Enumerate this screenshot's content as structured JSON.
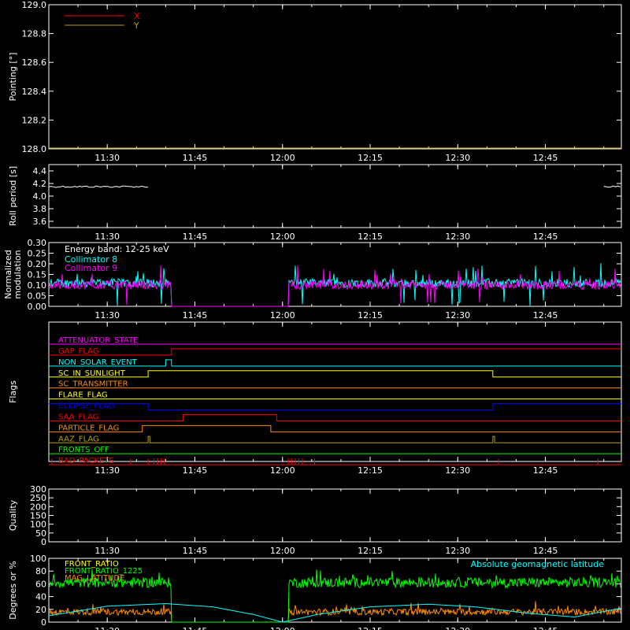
{
  "colors": {
    "background": "#000000",
    "axis": "#ffffff",
    "red": "#ff0000",
    "olive": "#b5a000",
    "cyan": "#00ffff",
    "magenta": "#ff00ff",
    "green": "#00ff00",
    "orange": "#ff8c00",
    "yellow": "#ffff00",
    "blue": "#0000ff",
    "white": "#ffffff"
  },
  "chart_data": [
    {
      "type": "line",
      "ylabel": "Pointing [°]",
      "ylim": [
        128.0,
        129.0
      ],
      "yticks": [
        "128.0",
        "128.2",
        "128.4",
        "128.6",
        "128.8",
        "129.0"
      ],
      "xticks": [
        "11:30",
        "11:45",
        "12:00",
        "12:15",
        "12:30",
        "12:45"
      ],
      "xlim": [
        "11:20",
        "12:58"
      ],
      "legend": [
        "X",
        "Y"
      ],
      "series": [
        {
          "name": "X",
          "color": "#ff0000",
          "values": []
        },
        {
          "name": "Y",
          "color": "#b5a000",
          "values": []
        }
      ]
    },
    {
      "type": "line",
      "ylabel": "Roll period [s]",
      "ylim": [
        3.5,
        4.5
      ],
      "yticks": [
        "3.6",
        "3.8",
        "4.0",
        "4.2",
        "4.4"
      ],
      "xticks": [
        "11:30",
        "11:45",
        "12:00",
        "12:15",
        "12:30",
        "12:45"
      ],
      "series": [
        {
          "name": "roll_period",
          "color": "#ffffff",
          "segments": [
            {
              "x": [
                "11:20",
                "11:37"
              ],
              "y": 4.15
            },
            {
              "x": [
                "12:55",
                "12:58"
              ],
              "y": 4.15
            }
          ]
        }
      ]
    },
    {
      "type": "line",
      "ylabel": "Normalized modulation",
      "ylim": [
        0.0,
        0.3
      ],
      "yticks": [
        "0.00",
        "0.05",
        "0.10",
        "0.15",
        "0.20",
        "0.25",
        "0.30"
      ],
      "xticks": [
        "11:30",
        "11:45",
        "12:00",
        "12:15",
        "12:30",
        "12:45"
      ],
      "annotation": "Energy band: 12-25 keV",
      "legend": [
        "Collimator 8",
        "Collimator 9"
      ],
      "series": [
        {
          "name": "Collimator 8",
          "color": "#00ffff",
          "mean": 0.11,
          "active": [
            [
              "11:20",
              "11:41"
            ],
            [
              "12:01",
              "12:58"
            ]
          ]
        },
        {
          "name": "Collimator 9",
          "color": "#ff00ff",
          "mean": 0.1,
          "active": [
            [
              "11:20",
              "11:41"
            ],
            [
              "12:01",
              "12:58"
            ]
          ]
        }
      ]
    },
    {
      "type": "line",
      "ylabel": "Flags",
      "xticks": [
        "11:30",
        "11:45",
        "12:00",
        "12:15",
        "12:30",
        "12:45"
      ],
      "flags": [
        {
          "label": "ATTENUATOR_STATE",
          "color": "#ff00ff",
          "high": []
        },
        {
          "label": "GAP_FLAG",
          "color": "#ff0000",
          "high": [
            [
              "11:41",
              "12:58"
            ]
          ]
        },
        {
          "label": "NON_SOLAR_EVENT",
          "color": "#00ffff",
          "high": [
            [
              "11:40",
              "11:41"
            ]
          ]
        },
        {
          "label": "SC_IN_SUNLIGHT",
          "color": "#ffff00",
          "high": [
            [
              "11:37",
              "12:36"
            ]
          ]
        },
        {
          "label": "SC_TRANSMITTER",
          "color": "#ff8c00",
          "high": []
        },
        {
          "label": "FLARE_FLAG",
          "color": "#ffff00",
          "high": []
        },
        {
          "label": "ECLIPSE_FLAG",
          "color": "#0000ff",
          "high": [
            [
              "11:20",
              "11:37"
            ],
            [
              "12:36",
              "12:58"
            ]
          ]
        },
        {
          "label": "SAA_FLAG",
          "color": "#ff0000",
          "high": [
            [
              "11:43",
              "11:59"
            ]
          ]
        },
        {
          "label": "PARTICLE_FLAG",
          "color": "#ff8c00",
          "high": [
            [
              "11:36",
              "11:58"
            ]
          ]
        },
        {
          "label": "AAZ_FLAG",
          "color": "#b5a000",
          "high": [
            [
              "11:37",
              "11:37.3"
            ],
            [
              "12:36",
              "12:36.3"
            ]
          ]
        },
        {
          "label": "FRONTS_OFF",
          "color": "#00ff00",
          "high": []
        },
        {
          "label": "BAD_PACKETS",
          "color": "#ff0000",
          "spikes": [
            "11:20.5",
            "11:34",
            "11:37",
            "11:38",
            "11:38.6",
            "11:39.2",
            "11:39.8",
            "12:01",
            "12:01.6",
            "12:02.2",
            "12:02.8",
            "12:03.4",
            "12:05.5",
            "12:37",
            "12:54"
          ]
        }
      ]
    },
    {
      "type": "line",
      "ylabel": "Quality",
      "ylim": [
        0,
        300
      ],
      "yticks": [
        "0",
        "50",
        "100",
        "150",
        "200",
        "250",
        "300"
      ],
      "xticks": [
        "11:30",
        "11:45",
        "12:00",
        "12:15",
        "12:30",
        "12:45"
      ],
      "series": []
    },
    {
      "type": "line",
      "ylabel": "Degrees or %",
      "ylim": [
        0,
        100
      ],
      "yticks": [
        "0",
        "20",
        "40",
        "60",
        "80",
        "100"
      ],
      "xticks": [
        "11:30",
        "11:45",
        "12:00",
        "12:15",
        "12:30",
        "12:45"
      ],
      "legend": [
        "FRONT_RATIO",
        "FRONT_RATIO_1225",
        "MAG_LATITUDE"
      ],
      "annotation": "Absolute geomagnetic latitude",
      "series": [
        {
          "name": "FRONT_RATIO",
          "color": "#ff8c00",
          "mean": 16,
          "active": [
            [
              "11:20",
              "11:41"
            ],
            [
              "12:01",
              "12:58"
            ]
          ]
        },
        {
          "name": "FRONT_RATIO_1225",
          "color": "#00ff00",
          "mean": 62,
          "active": [
            [
              "11:20",
              "11:41"
            ],
            [
              "12:01",
              "12:58"
            ]
          ]
        },
        {
          "name": "MAG_LATITUDE",
          "color": "#00ffff",
          "points": [
            [
              "11:20",
              10
            ],
            [
              "11:30",
              25
            ],
            [
              "11:40",
              29
            ],
            [
              "11:48",
              24
            ],
            [
              "11:55",
              12
            ],
            [
              "12:00",
              0
            ],
            [
              "12:06",
              12
            ],
            [
              "12:15",
              24
            ],
            [
              "12:25",
              28
            ],
            [
              "12:33",
              24
            ],
            [
              "12:42",
              14
            ],
            [
              "12:50",
              8
            ],
            [
              "12:58",
              22
            ]
          ]
        }
      ]
    }
  ]
}
